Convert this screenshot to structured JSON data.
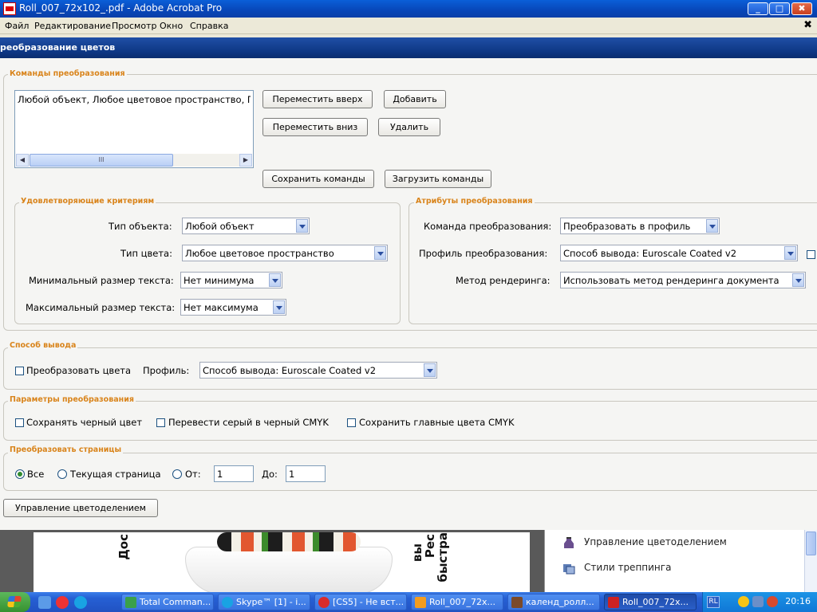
{
  "window": {
    "title": "Roll_007_72x102_.pdf - Adobe Acrobat Pro",
    "min_label": "_",
    "max_label": "□",
    "close_label": "✖"
  },
  "menu": {
    "items": [
      "Файл",
      "Редактирование",
      "Просмотр",
      "Окно",
      "Справка"
    ],
    "close_label": "✖"
  },
  "dialog": {
    "title": "реобразование цветов"
  },
  "commands": {
    "section_title": "Команды преобразования",
    "list_items": [
      "Любой объект, Любое цветовое пространство, Пре"
    ],
    "scroll_thumb": "III",
    "scroll_left": "◀",
    "scroll_right": "▶",
    "move_up": "Переместить вверх",
    "add": "Добавить",
    "move_down": "Переместить вниз",
    "delete": "Удалить",
    "save": "Сохранить команды",
    "load": "Загрузить команды"
  },
  "criteria": {
    "section_title": "Удовлетворяющие критериям",
    "object_type_label": "Тип объекта:",
    "object_type_value": "Любой объект",
    "color_type_label": "Тип цвета:",
    "color_type_value": "Любое цветовое пространство",
    "min_text_label": "Минимальный размер текста:",
    "min_text_value": "Нет минимума",
    "max_text_label": "Максимальный размер текста:",
    "max_text_value": "Нет максимума"
  },
  "attributes": {
    "section_title": "Атрибуты преобразования",
    "command_label": "Команда преобразования:",
    "command_value": "Преобразовать в профиль",
    "profile_label": "Профиль преобразования:",
    "profile_value": "Способ вывода: Euroscale Coated v2",
    "render_label": "Метод рендеринга:",
    "render_value": "Использовать метод рендеринга документа"
  },
  "output": {
    "section_title": "Способ вывода",
    "convert_label": "Преобразовать цвета",
    "convert_checked": false,
    "profile_label": "Профиль:",
    "profile_value": "Способ вывода: Euroscale Coated v2"
  },
  "params": {
    "section_title": "Параметры преобразования",
    "keep_black": "Сохранять черный цвет",
    "gray_to_cmyk": "Перевести серый в черный CMYK",
    "keep_cmyk": "Сохранить главные цвета CMYK"
  },
  "pages": {
    "section_title": "Преобразовать страницы",
    "all": "Все",
    "current": "Текущая страница",
    "from_label": "От:",
    "from_value": "1",
    "to_label": "До:",
    "to_value": "1",
    "selected": "all"
  },
  "separation_button": "Управление цветоделением",
  "document": {
    "text_left": "Дос",
    "text_right_1": "вы",
    "text_right_2": "Рес",
    "text_right_3": "быстра"
  },
  "side_panel": {
    "items": [
      "Управление цветоделением",
      "Стили треппинга"
    ]
  },
  "taskbar": {
    "tasks": [
      {
        "label": "Total Comman...",
        "color": "#3aa04a",
        "active": false
      },
      {
        "label": "Skype™ [1] - i...",
        "color": "#19a3e3",
        "active": false
      },
      {
        "label": "[CS5] - Не вст...",
        "color": "#d92b2b",
        "active": false
      },
      {
        "label": "Roll_007_72x...",
        "color": "#f39c1f",
        "active": false
      },
      {
        "label": "календ_ролл...",
        "color": "#7b4a2a",
        "active": false
      },
      {
        "label": "Roll_007_72x...",
        "color": "#cc2222",
        "active": true
      }
    ],
    "language": "RL",
    "clock": "20:16"
  }
}
